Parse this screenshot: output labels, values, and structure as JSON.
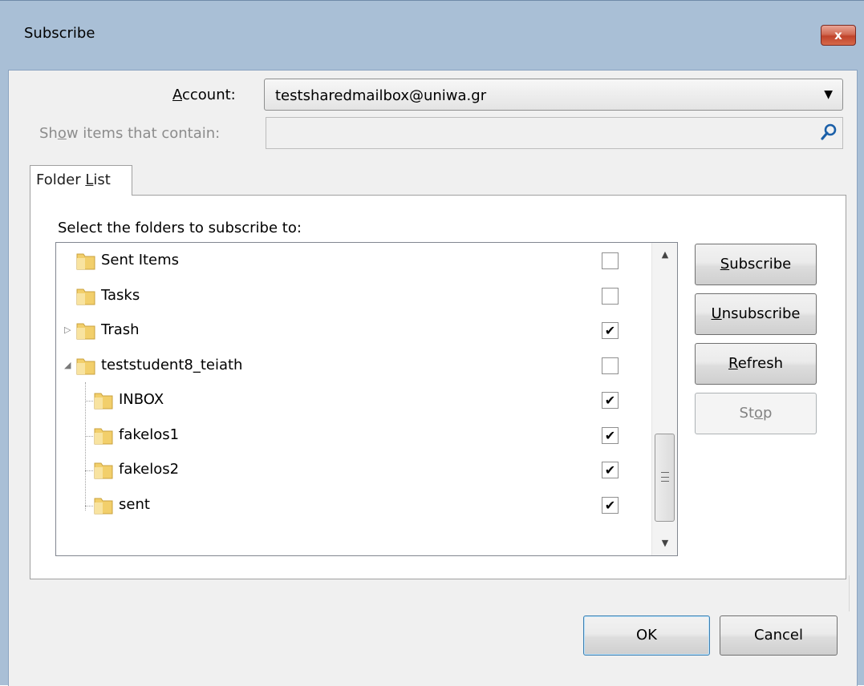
{
  "window": {
    "title": "Subscribe",
    "close_glyph": "x"
  },
  "account": {
    "label": "Account:",
    "label_mnemonic": "A",
    "label_rest": "ccount:",
    "value": "testsharedmailbox@uniwa.gr"
  },
  "search": {
    "label_before": "Sh",
    "label_mnemonic": "o",
    "label_after": "w items that contain:",
    "value": ""
  },
  "tab": {
    "label_before": "Folder ",
    "label_mnemonic": "L",
    "label_after": "ist"
  },
  "panel": {
    "instruction": "Select the folders to subscribe to:"
  },
  "folders": [
    {
      "name": "Sent Items",
      "checked": false,
      "level": 0,
      "expander": ""
    },
    {
      "name": "Tasks",
      "checked": false,
      "level": 0,
      "expander": ""
    },
    {
      "name": "Trash",
      "checked": true,
      "level": 0,
      "expander": "collapsed"
    },
    {
      "name": "teststudent8_teiath",
      "checked": false,
      "level": 0,
      "expander": "expanded"
    },
    {
      "name": "INBOX",
      "checked": true,
      "level": 1,
      "expander": ""
    },
    {
      "name": "fakelos1",
      "checked": true,
      "level": 1,
      "expander": ""
    },
    {
      "name": "fakelos2",
      "checked": true,
      "level": 1,
      "expander": ""
    },
    {
      "name": "sent",
      "checked": true,
      "level": 1,
      "expander": ""
    }
  ],
  "buttons": {
    "subscribe": {
      "mnemonic": "S",
      "rest": "ubscribe"
    },
    "unsubscribe": {
      "mnemonic": "U",
      "rest": "nsubscribe"
    },
    "refresh": {
      "mnemonic": "R",
      "rest": "efresh"
    },
    "stop": {
      "before": "St",
      "mnemonic": "o",
      "after": "p"
    },
    "ok": "OK",
    "cancel": "Cancel"
  },
  "colors": {
    "frame": "#a9bfd6",
    "client": "#f0f0f0",
    "folder": "#f2cf6b",
    "ok_border": "#3c7fb1"
  }
}
